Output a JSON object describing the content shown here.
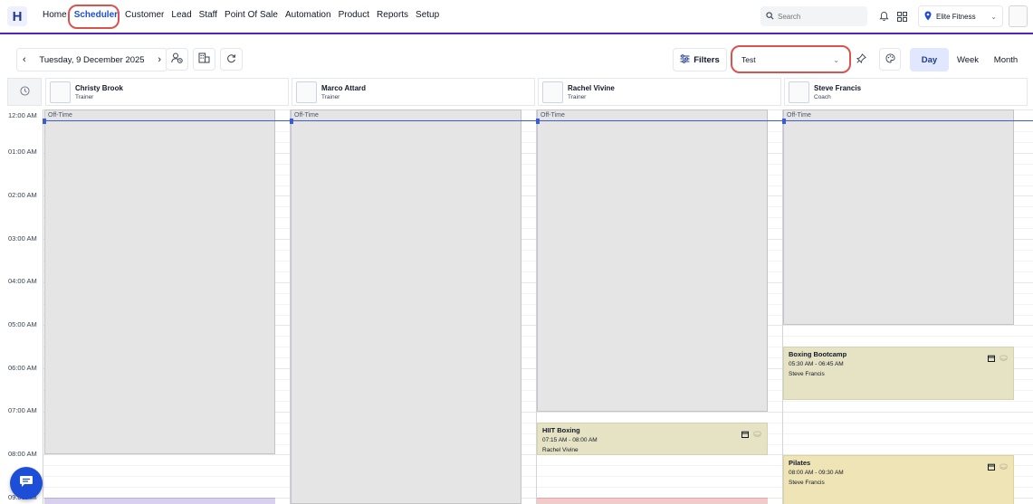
{
  "brand": {
    "logo_letter": "H",
    "accent": "#1d4ed8",
    "nav_border": "#5b21b6",
    "highlight": "#d9534f"
  },
  "nav": {
    "items": [
      {
        "label": "Home",
        "active": false
      },
      {
        "label": "Scheduler",
        "active": true
      },
      {
        "label": "Customer",
        "active": false
      },
      {
        "label": "Lead",
        "active": false
      },
      {
        "label": "Staff",
        "active": false
      },
      {
        "label": "Point Of Sale",
        "active": false
      },
      {
        "label": "Automation",
        "active": false
      },
      {
        "label": "Product",
        "active": false
      },
      {
        "label": "Reports",
        "active": false
      },
      {
        "label": "Setup",
        "active": false
      }
    ],
    "search_placeholder": "Search",
    "organization": "Elite Fitness"
  },
  "toolbar": {
    "date": "Tuesday, 9 December 2025",
    "filters_label": "Filters",
    "selected_filter": "Test",
    "views": [
      "Day",
      "Week",
      "Month"
    ],
    "active_view": "Day"
  },
  "staff": [
    {
      "name": "Christy Brook",
      "role": "Trainer"
    },
    {
      "name": "Marco Attard",
      "role": "Trainer"
    },
    {
      "name": "Rachel Vivine",
      "role": "Trainer"
    },
    {
      "name": "Steve Francis",
      "role": "Coach"
    }
  ],
  "time_labels": [
    "12:00 AM",
    "01:00 AM",
    "02:00 AM",
    "03:00 AM",
    "04:00 AM",
    "05:00 AM",
    "06:00 AM",
    "07:00 AM",
    "08:00 AM",
    "09:00 AM"
  ],
  "offtime_label": "Off-Time",
  "events": [
    {
      "title": "Boxing Bootcamp",
      "time": "05:30 AM - 06:45 AM",
      "staff": "Steve Francis",
      "color": "#e6e3c4"
    },
    {
      "title": "HIIT Boxing",
      "time": "07:15 AM - 08:00 AM",
      "staff": "Rachel Vivine",
      "color": "#e6e3c4"
    },
    {
      "title": "Pilates",
      "time": "08:00 AM - 09:30 AM",
      "staff": "Steve Francis",
      "color": "#efe4b5"
    }
  ]
}
